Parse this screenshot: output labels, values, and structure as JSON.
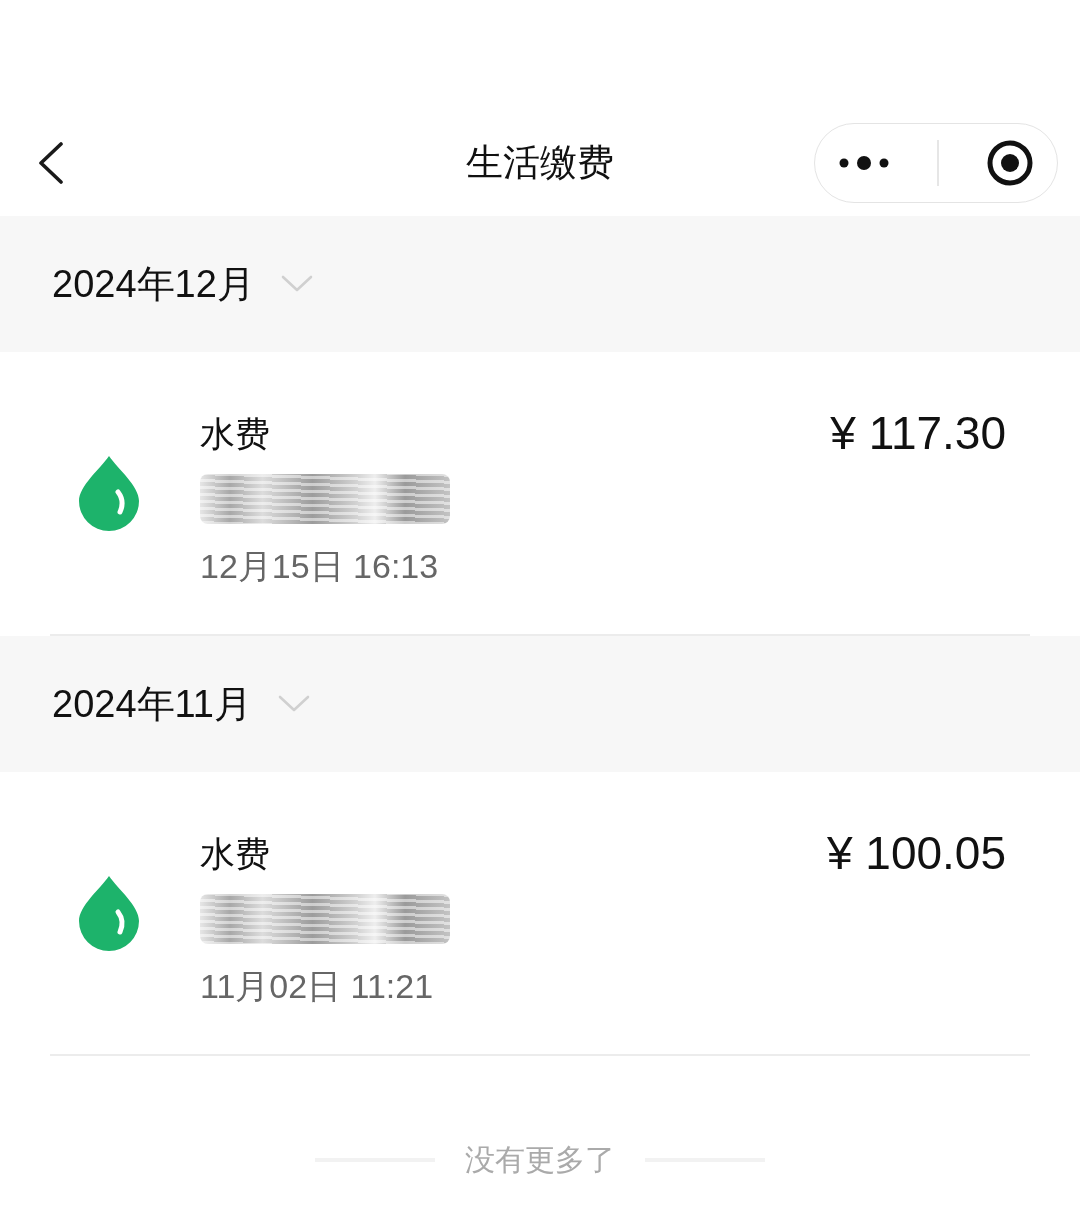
{
  "nav": {
    "title": "生活缴费"
  },
  "months": [
    {
      "label": "2024年12月",
      "records": [
        {
          "title": "水费",
          "amount": "¥ 117.30",
          "time": "12月15日 16:13",
          "detail_redacted": true
        }
      ]
    },
    {
      "label": "2024年11月",
      "records": [
        {
          "title": "水费",
          "amount": "¥ 100.05",
          "time": "11月02日 11:21",
          "detail_redacted": true
        }
      ]
    }
  ],
  "footer": {
    "text": "没有更多了"
  }
}
